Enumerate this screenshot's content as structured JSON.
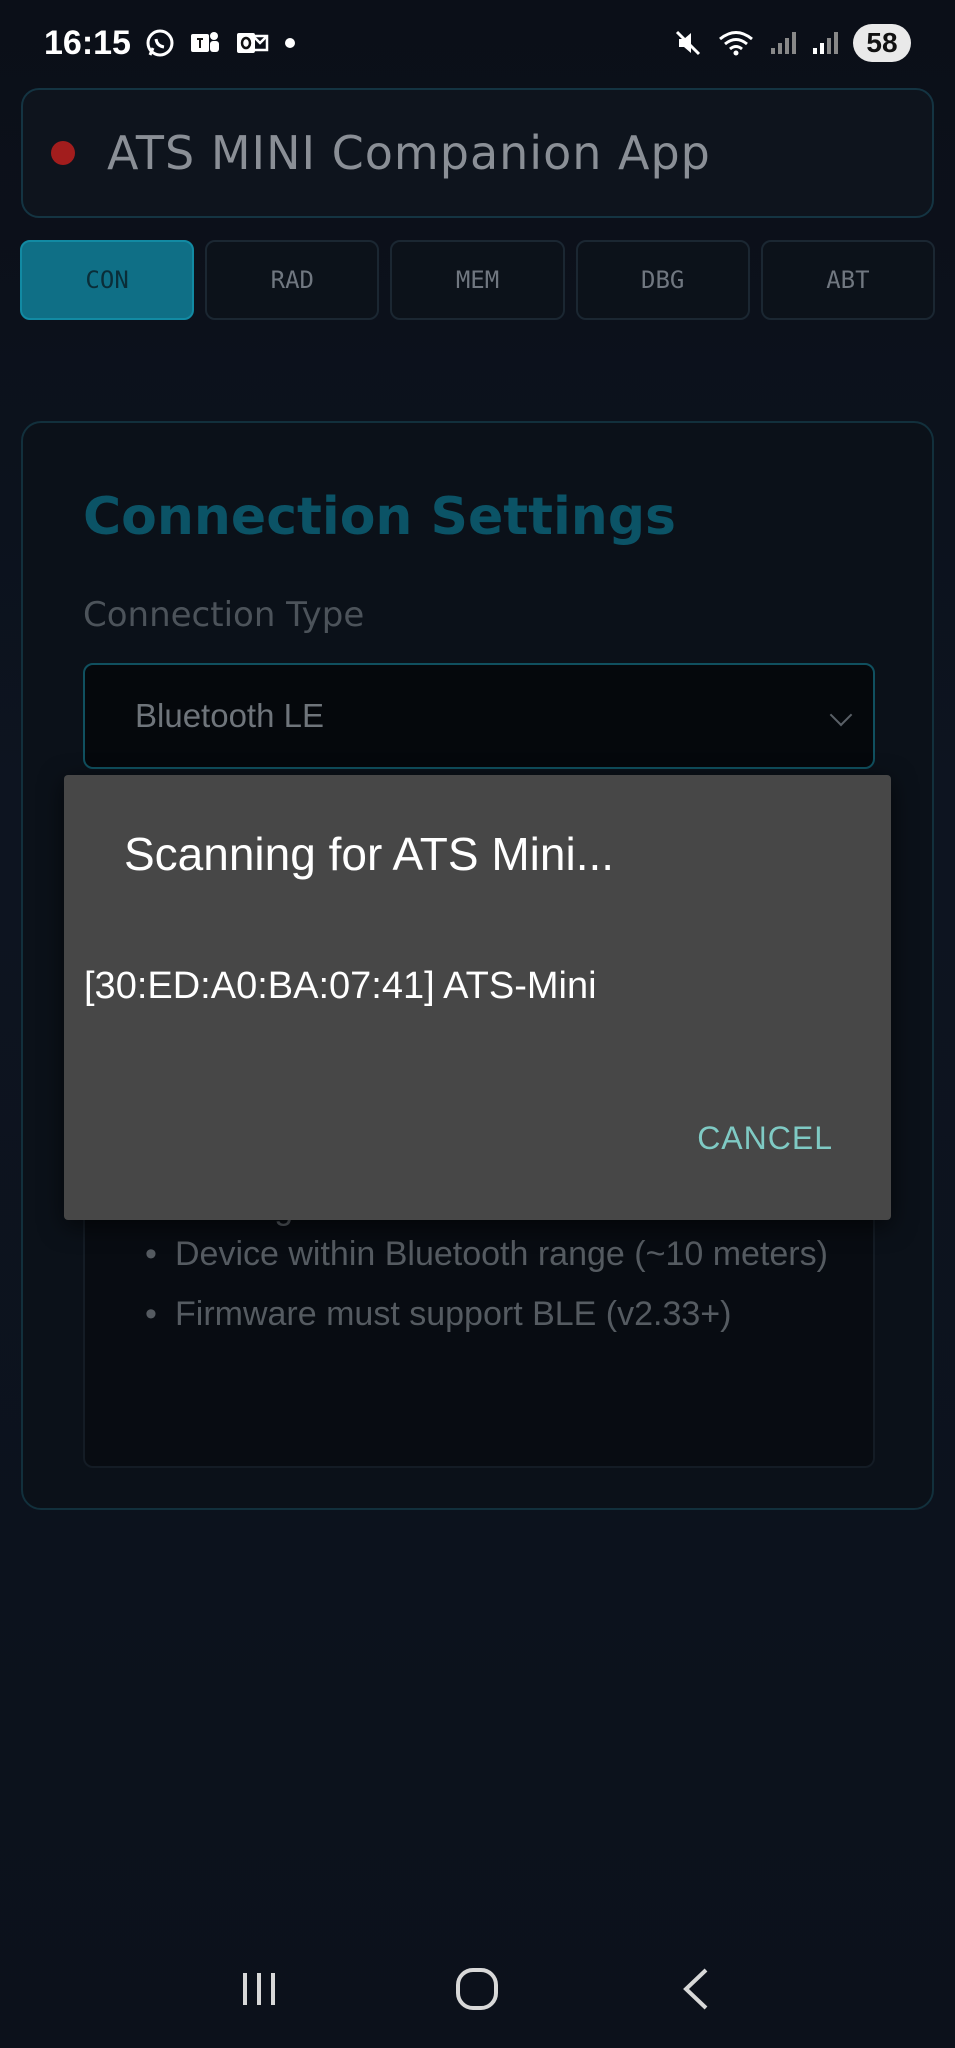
{
  "status_bar": {
    "time": "16:15",
    "battery": "58",
    "icons": [
      "whatsapp-icon",
      "teams-icon",
      "outlook-icon",
      "dot-icon",
      "mute-icon",
      "wifi-icon",
      "signal-icon",
      "signal-icon"
    ]
  },
  "header": {
    "title": "ATS MINI Companion App",
    "status_color": "#a21d1d"
  },
  "tabs": [
    {
      "label": "CON",
      "active": true
    },
    {
      "label": "RAD",
      "active": false
    },
    {
      "label": "MEM",
      "active": false
    },
    {
      "label": "DBG",
      "active": false
    },
    {
      "label": "ABT",
      "active": false
    }
  ],
  "settings": {
    "title": "Connection Settings",
    "connection_type_label": "Connection Type",
    "connection_type_value": "Bluetooth LE",
    "notes": {
      "partial_text": "settings",
      "items": [
        "Device within Bluetooth range (~10 meters)",
        "Firmware must support BLE (v2.33+)"
      ]
    }
  },
  "dialog": {
    "title": "Scanning for ATS Mini...",
    "devices": [
      "[30:ED:A0:BA:07:41] ATS-Mini"
    ],
    "cancel_label": "CANCEL",
    "accent_color": "#7fcac4"
  },
  "nav_bar": {
    "icons": [
      "recent-apps-icon",
      "home-icon",
      "back-icon"
    ]
  },
  "colors": {
    "accent": "#0f6f86",
    "background": "#0b0f18"
  }
}
